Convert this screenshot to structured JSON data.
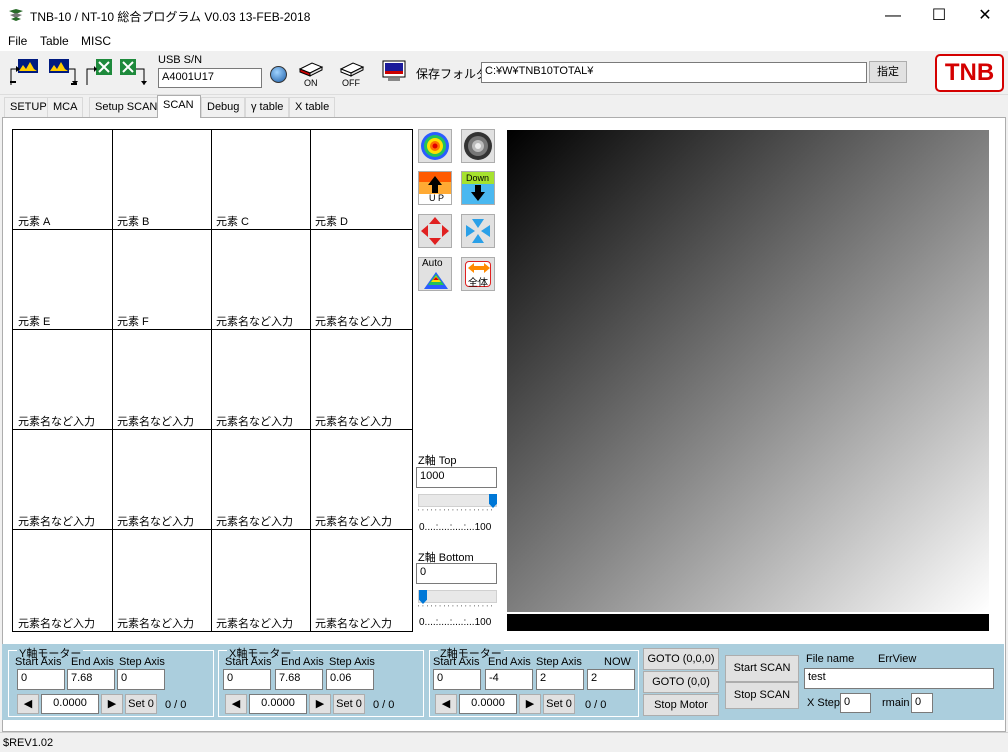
{
  "window": {
    "title": "TNB-10 / NT-10  総合プログラム  V0.03 13-FEB-2018"
  },
  "menu": [
    "File",
    "Table",
    "MISC"
  ],
  "toolbar": {
    "usb_label": "USB S/N",
    "usb_value": "A4001U17",
    "on_label": "ON",
    "off_label": "OFF",
    "folder_label": "保存フォルダ",
    "folder_value": "C:¥W¥TNB10TOTAL¥",
    "specify_button": "指定",
    "logo": "TNB"
  },
  "tabs": [
    "SETUP",
    "MCA",
    "Setup SCAN",
    "SCAN",
    "Debug",
    "γ table",
    "X table"
  ],
  "active_tab": "SCAN",
  "elements_grid": [
    [
      "元素 A",
      "元素 B",
      "元素 C",
      "元素 D"
    ],
    [
      "元素 E",
      "元素 F",
      "元素名など入力",
      "元素名など入力"
    ],
    [
      "元素名など入力",
      "元素名など入力",
      "元素名など入力",
      "元素名など入力"
    ],
    [
      "元素名など入力",
      "元素名など入力",
      "元素名など入力",
      "元素名など入力"
    ],
    [
      "元素名など入力",
      "元素名など入力",
      "元素名など入力",
      "元素名など入力"
    ]
  ],
  "side_buttons": {
    "up": "U P",
    "down": "Down",
    "auto": "Auto",
    "all": "全体"
  },
  "z_top": {
    "label": "Z軸 Top",
    "value": "1000",
    "scale": "0....:....:....:...100",
    "level": 1.0
  },
  "z_bottom": {
    "label": "Z軸 Bottom",
    "value": "0",
    "scale": "0....:....:....:...100",
    "level": 0.0
  },
  "y_motor": {
    "title": "Y軸モーター",
    "start_label": "Start Axis",
    "end_label": "End Axis",
    "step_label": "Step Axis",
    "start": "0",
    "end": "7.68",
    "step": "0",
    "pos": "0.0000",
    "set0": "Set 0",
    "count": "0 / 0"
  },
  "x_motor": {
    "title": "X軸モーター",
    "start_label": "Start Axis",
    "end_label": "End Axis",
    "step_label": "Step Axis",
    "start": "0",
    "end": "7.68",
    "step": "0.06",
    "pos": "0.0000",
    "set0": "Set 0",
    "count": "0 / 0"
  },
  "z_motor": {
    "title": "Z軸モーター",
    "start_label": "Start Axis",
    "end_label": "End Axis",
    "step_label": "Step Axis",
    "now_label": "NOW",
    "start": "0",
    "end": "-4",
    "step": "2",
    "now": "2",
    "pos": "0.0000",
    "set0": "Set 0",
    "count": "0 / 0"
  },
  "goto": {
    "b1": "GOTO (0,0,0)",
    "b2": "GOTO (0,0)",
    "stop_motor": "Stop Motor"
  },
  "scan": {
    "start": "Start SCAN",
    "stop": "Stop SCAN"
  },
  "file": {
    "name_label": "File name",
    "errview_label": "ErrView",
    "name_value": "test",
    "xstep_label": "X Step",
    "xstep_value": "0",
    "rmain_label": "rmain",
    "rmain_value": "0"
  },
  "status": "$REV1.02",
  "arrows": {
    "left": "◀",
    "right": "▶"
  }
}
